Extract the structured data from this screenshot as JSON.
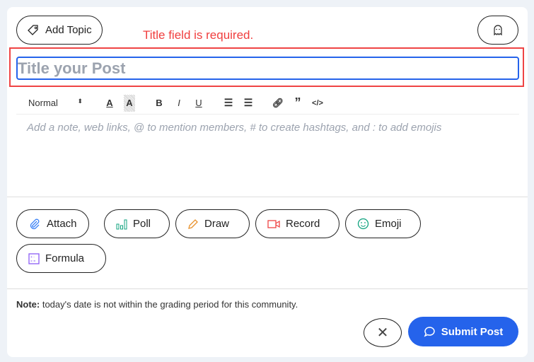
{
  "header": {
    "add_topic_label": "Add Topic",
    "error_text": "Title field is required."
  },
  "title": {
    "placeholder": "Title your Post",
    "value": ""
  },
  "toolbar": {
    "format_select": "Normal",
    "items": [
      "text-color",
      "highlight",
      "bold",
      "italic",
      "underline",
      "ordered-list",
      "bullet-list",
      "link",
      "quote",
      "code"
    ]
  },
  "editor": {
    "placeholder": "Add a note, web links, @ to mention members, # to create hashtags, and : to add emojis"
  },
  "actions": [
    {
      "label": "Attach",
      "icon": "paperclip-icon",
      "color": "#3b82f6"
    },
    {
      "label": "Poll",
      "icon": "bar-chart-icon",
      "color": "#10a37f"
    },
    {
      "label": "Draw",
      "icon": "pencil-icon",
      "color": "#e8912d"
    },
    {
      "label": "Record",
      "icon": "video-camera-icon",
      "color": "#ef4444"
    },
    {
      "label": "Emoji",
      "icon": "smiley-icon",
      "color": "#10a37f"
    },
    {
      "label": "Formula",
      "icon": "calculator-icon",
      "color": "#8b5cf6"
    }
  ],
  "footer": {
    "note_bold": "Note:",
    "note_text": " today's date is not within the grading period for this community.",
    "submit_label": "Submit Post"
  },
  "colors": {
    "primary": "#2563eb",
    "error": "#ef4444"
  }
}
